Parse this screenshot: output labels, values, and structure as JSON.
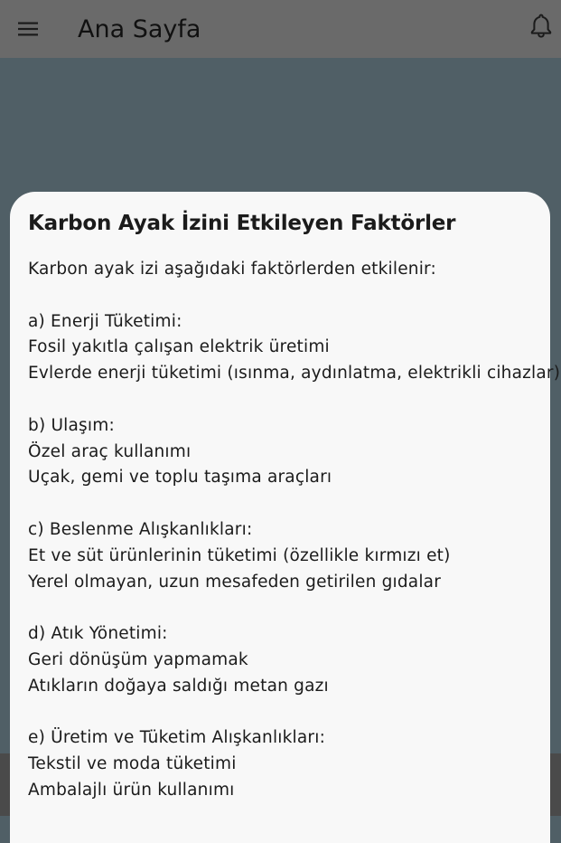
{
  "appbar": {
    "title": "Ana Sayfa",
    "menu_icon": "menu-icon",
    "notification_icon": "bell-icon"
  },
  "sheet": {
    "title": "Karbon Ayak İzini Etkileyen Faktörler",
    "lines": [
      "Karbon ayak izi aşağıdaki faktörlerden etkilenir:",
      "",
      "a) Enerji Tüketimi:",
      "Fosil yakıtla çalışan elektrik üretimi",
      "Evlerde enerji tüketimi (ısınma, aydınlatma, elektrikli cihazlar)",
      "",
      "b) Ulaşım:",
      "Özel araç kullanımı",
      "Uçak, gemi ve toplu taşıma araçları",
      "",
      "c) Beslenme Alışkanlıkları:",
      "Et ve süt ürünlerinin tüketimi (özellikle kırmızı et)",
      "Yerel olmayan, uzun mesafeden getirilen gıdalar",
      "",
      "d) Atık Yönetimi:",
      "Geri dönüşüm yapmamak",
      "Atıkların doğaya saldığı metan gazı",
      "",
      "e) Üretim ve Tüketim Alışkanlıkları:",
      "Tekstil ve moda tüketimi",
      "Ambalajlı ürün kullanımı"
    ]
  },
  "colors": {
    "appbar": "#6a6a6a",
    "scrim": "#505f66",
    "sheet": "#f8f8f8",
    "text": "#1b1b1b"
  }
}
